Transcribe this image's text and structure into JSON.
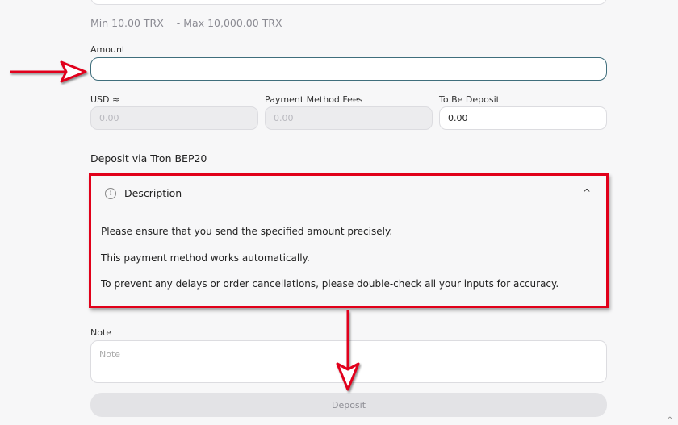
{
  "limits": {
    "min": "Min 10.00 TRX",
    "max": "- Max 10,000.00 TRX"
  },
  "amount": {
    "label": "Amount",
    "value": ""
  },
  "usd": {
    "label": "USD ≈",
    "placeholder": "0.00"
  },
  "fees": {
    "label": "Payment Method Fees",
    "placeholder": "0.00"
  },
  "to_be_deposit": {
    "label": "To Be Deposit",
    "value": "0.00"
  },
  "deposit_via": "Deposit via Tron BEP20",
  "description": {
    "title": "Description",
    "info_icon": "i",
    "chevron": "^",
    "lines": [
      "Please ensure that you send the specified amount precisely.",
      "This payment method works automatically.",
      "To prevent any delays or order cancellations, please double-check all your inputs for accuracy."
    ]
  },
  "note": {
    "label": "Note",
    "placeholder": "Note"
  },
  "deposit_button": "Deposit",
  "corner_caret": "^",
  "colors": {
    "highlight": "#e1001a",
    "focus_border": "#3f6e7c"
  },
  "icons": [
    "info-icon",
    "chevron-up-icon",
    "red-arrow-right-icon",
    "red-arrow-down-icon"
  ]
}
